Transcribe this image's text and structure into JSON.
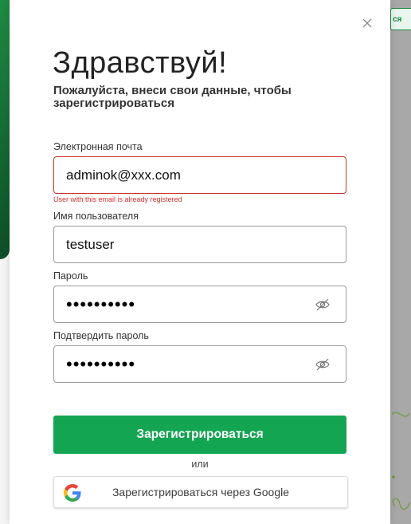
{
  "background": {
    "partial_button_text": "ся"
  },
  "modal": {
    "title": "Здравствуй!",
    "subtitle": "Пожалуйста, внеси свои данные, чтобы зарегистрироваться",
    "email": {
      "label": "Электронная почта",
      "value": "adminok@xxx.com",
      "error": "User with this email is already registered"
    },
    "username": {
      "label": "Имя пользователя",
      "value": "testuser"
    },
    "password": {
      "label": "Пароль",
      "value": "••••••••••"
    },
    "confirm_password": {
      "label": "Подтвердить пароль",
      "value": "••••••••••"
    },
    "submit_label": "Зарегистрироваться",
    "or_text": "или",
    "google_label": "Зарегистрироваться через Google"
  },
  "colors": {
    "primary_green": "#13a552",
    "error_red": "#d0312d",
    "dark_green": "#0f5a2c"
  },
  "icons": [
    "close-icon",
    "eye-off-icon",
    "google-icon"
  ]
}
